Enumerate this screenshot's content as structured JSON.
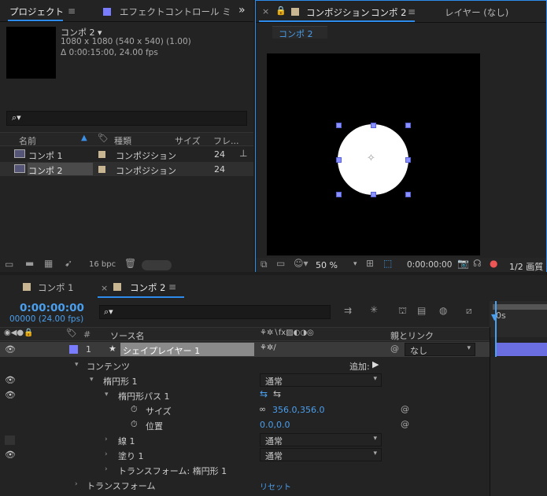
{
  "project_panel": {
    "tab_project": "プロジェクト",
    "tab_effects": "エフェクトコントロール ミ",
    "overflow": "»",
    "comp_name": "コンポ 2 ▾",
    "comp_info1": "1080 x 1080  (540 x 540) (1.00)",
    "comp_info2": "Δ 0:00:15:00, 24.00 fps",
    "search_placeholder": "",
    "columns": [
      "名前",
      "種類",
      "サイズ",
      "フレ..."
    ],
    "items": [
      {
        "name": "コンポ 1",
        "type": "コンポジション",
        "fps": "24"
      },
      {
        "name": "コンポ 2",
        "type": "コンポジション",
        "fps": "24"
      }
    ],
    "bpc": "16 bpc"
  },
  "viewer_panel": {
    "tab_label": "コンポジション",
    "tab_comp": "コンポ 2",
    "layer_label": "レイヤー (なし)",
    "breadcrumb": "コンポ 2",
    "zoom": "50 %",
    "timecode": "0:00:00:00",
    "resolution": "1/2 画質"
  },
  "timeline": {
    "tab1": "コンポ 1",
    "tab2": "コンポ 2",
    "timecode": "0:00:00:00",
    "frames": "00000 (24.00 fps)",
    "header_num": "#",
    "header_source": "ソース名",
    "header_parent": "親とリンク",
    "ruler_label": "0s",
    "layer": {
      "index": "1",
      "name": "シェイプレイヤー 1",
      "parent": "なし"
    },
    "rows": [
      {
        "label": "コンテンツ",
        "extra": "追加:"
      },
      {
        "label": "楕円形 1",
        "mode": "通常"
      },
      {
        "label": "楕円形パス 1"
      },
      {
        "label": "サイズ",
        "value": "356.0,356.0"
      },
      {
        "label": "位置",
        "value": "0.0,0.0"
      },
      {
        "label": "線 1",
        "mode": "通常"
      },
      {
        "label": "塗り 1",
        "mode": "通常"
      },
      {
        "label": "トランスフォーム: 楕円形 1"
      },
      {
        "label": "トランスフォーム",
        "value": "リセット"
      }
    ]
  },
  "colors": {
    "accent": "#2d8ceb",
    "comp_swatch": "#c8b591",
    "layer_label": "#7a7cff"
  }
}
